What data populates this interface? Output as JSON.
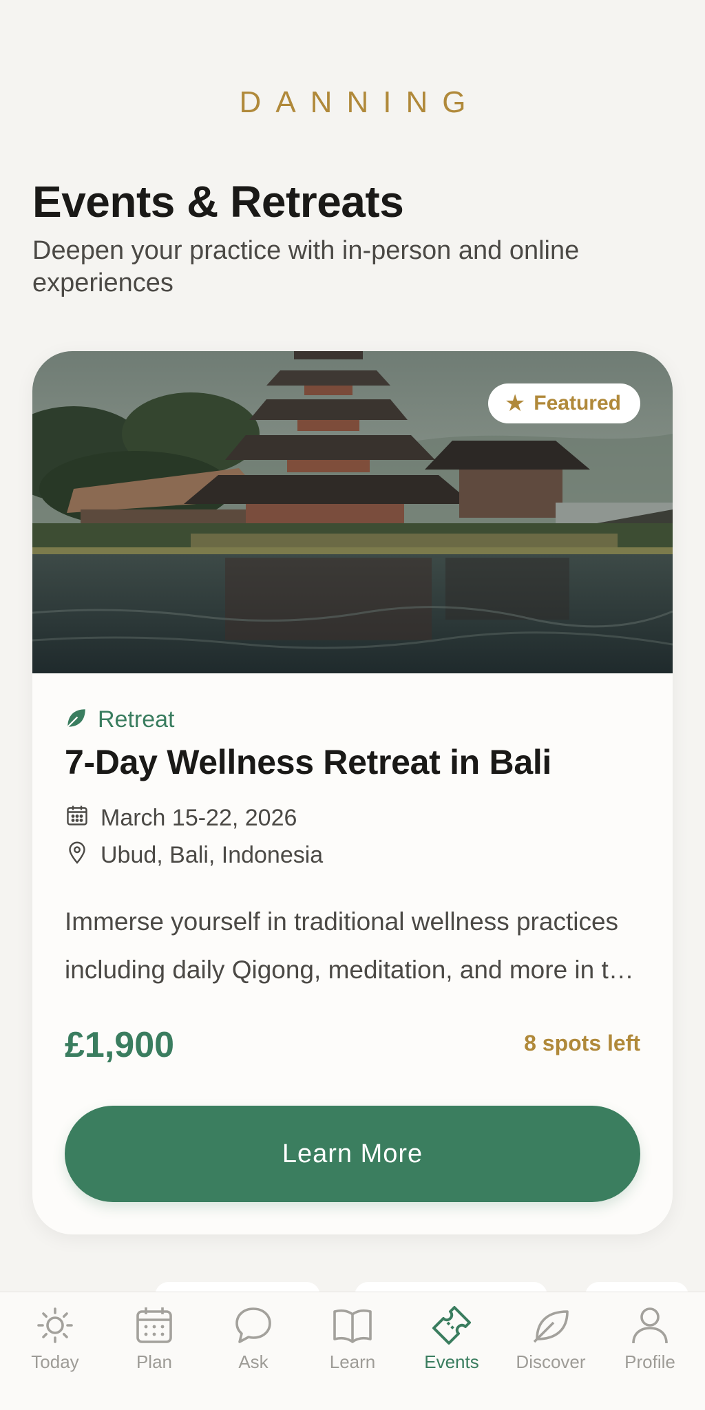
{
  "brand": "DANNING",
  "header": {
    "title": "Events & Retreats",
    "subtitle": "Deepen your practice with in-person and online experiences"
  },
  "event": {
    "badge": "Featured",
    "category": "Retreat",
    "title": "7-Day Wellness Retreat in Bali",
    "date": "March 15-22, 2026",
    "location": "Ubud, Bali, Indonesia",
    "description": "Immerse yourself in traditional wellness practices including daily Qigong, meditation, and more in the heart of Bali.",
    "price": "£1,900",
    "spots": "8 spots left",
    "cta": "Learn More"
  },
  "tabs": [
    {
      "label": "Today",
      "icon": "sun-icon",
      "active": false
    },
    {
      "label": "Plan",
      "icon": "calendar-icon",
      "active": false
    },
    {
      "label": "Ask",
      "icon": "chat-bubble-icon",
      "active": false
    },
    {
      "label": "Learn",
      "icon": "open-book-icon",
      "active": false
    },
    {
      "label": "Events",
      "icon": "ticket-icon",
      "active": true
    },
    {
      "label": "Discover",
      "icon": "leaf-icon",
      "active": false
    },
    {
      "label": "Profile",
      "icon": "person-icon",
      "active": false
    }
  ],
  "colors": {
    "accent_green": "#3b7e5f",
    "accent_gold": "#b0893a",
    "background": "#f5f4f1"
  }
}
